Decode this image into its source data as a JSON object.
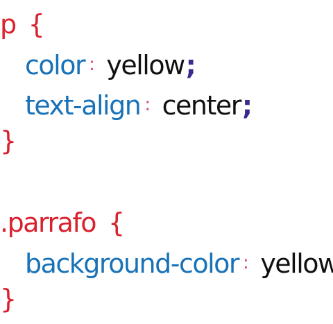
{
  "rules": [
    {
      "selector": "p",
      "open_brace": "{",
      "close_brace": "}",
      "declarations": [
        {
          "property": "color",
          "colon": ":",
          "value": "yellow",
          "semicolon": ";"
        },
        {
          "property": "text-align",
          "colon": ":",
          "value": "center",
          "semicolon": ";"
        }
      ]
    },
    {
      "selector": ".parrafo",
      "open_brace": "{",
      "close_brace": "}",
      "declarations": [
        {
          "property": "background-color",
          "colon": ":",
          "value": "yellow",
          "semicolon": ";"
        }
      ]
    }
  ],
  "colors": {
    "selector": "#d9212e",
    "property": "#1872b8",
    "colon": "#e23d8f",
    "value": "#111111",
    "semicolon": "#3a2a8e"
  }
}
